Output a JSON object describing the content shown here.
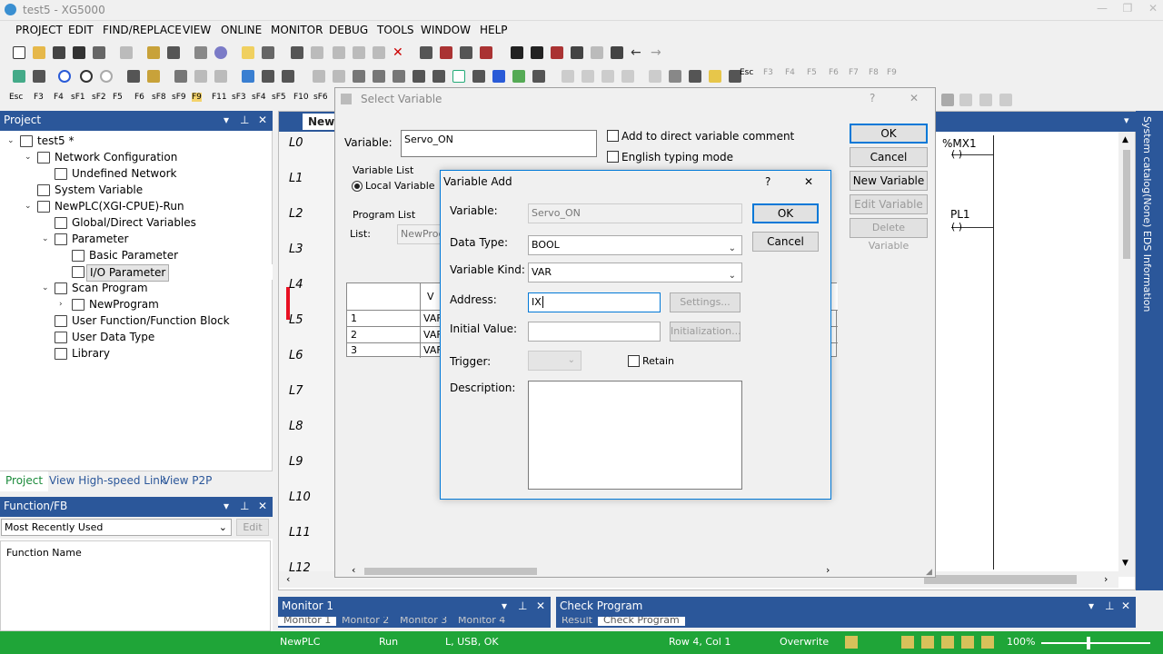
{
  "app": {
    "title": "test5 - XG5000"
  },
  "menu": [
    "PROJECT",
    "EDIT",
    "FIND/REPLACE",
    "VIEW",
    "ONLINE",
    "MONITOR",
    "DEBUG",
    "TOOLS",
    "WINDOW",
    "HELP"
  ],
  "toolbar3": [
    "Esc",
    "F3",
    "F4",
    "sF1",
    "sF2",
    "F5",
    "F6",
    "sF8",
    "sF9",
    "F9",
    "F11",
    "sF3",
    "sF4",
    "sF5",
    "F10",
    "sF6"
  ],
  "toolbar2_right": [
    "Esc",
    "F3",
    "F4",
    "F5",
    "F6",
    "F7",
    "F8",
    "F9"
  ],
  "project_pane": {
    "title": "Project",
    "tree": [
      {
        "label": "test5 *",
        "level": 0,
        "exp": "⌄"
      },
      {
        "label": "Network Configuration",
        "level": 1,
        "exp": "⌄"
      },
      {
        "label": "Undefined Network",
        "level": 2,
        "exp": ""
      },
      {
        "label": "System Variable",
        "level": 1,
        "exp": ""
      },
      {
        "label": "NewPLC(XGI-CPUE)-Run",
        "level": 1,
        "exp": "⌄"
      },
      {
        "label": "Global/Direct Variables",
        "level": 2,
        "exp": ""
      },
      {
        "label": "Parameter",
        "level": 2,
        "exp": "⌄"
      },
      {
        "label": "Basic Parameter",
        "level": 3,
        "exp": ""
      },
      {
        "label": "I/O Parameter",
        "level": 3,
        "exp": ""
      },
      {
        "label": "Scan Program",
        "level": 2,
        "exp": "⌄"
      },
      {
        "label": "NewProgram",
        "level": 3,
        "exp": "›"
      },
      {
        "label": "User Function/Function Block",
        "level": 2,
        "exp": ""
      },
      {
        "label": "User Data Type",
        "level": 2,
        "exp": ""
      },
      {
        "label": "Library",
        "level": 2,
        "exp": ""
      }
    ],
    "tabs": [
      "Project",
      "View High-speed Link",
      "View P2P"
    ]
  },
  "function_pane": {
    "title": "Function/FB",
    "filter": "Most Recently Used",
    "edit": "Edit",
    "col": "Function Name"
  },
  "editor": {
    "tab": "NewF",
    "rungs": [
      "L0",
      "L1",
      "L2",
      "L3",
      "L4",
      "L5",
      "L6",
      "L7",
      "L8",
      "L9",
      "L10",
      "L11",
      "L12"
    ],
    "contacts": [
      "%MX1",
      "PL1"
    ]
  },
  "right_strip": "System catalog(None)  EDS Information",
  "select_variable": {
    "title": "Select Variable",
    "help": "?",
    "close": "✕",
    "variable_label": "Variable:",
    "variable_value": "Servo_ON",
    "add_comment": "Add to direct variable comment",
    "english_mode": "English typing mode",
    "variable_list": "Variable List",
    "local_variable": "Local Variable",
    "program_list": "Program List",
    "list_label": "List:",
    "list_value": "NewProgr",
    "rows": [
      {
        "n": "1",
        "v": "VAF"
      },
      {
        "n": "2",
        "v": "VAF"
      },
      {
        "n": "3",
        "v": "VAF"
      }
    ],
    "col_head": "V",
    "buttons": {
      "ok": "OK",
      "cancel": "Cancel",
      "new": "New Variable",
      "edit": "Edit Variable",
      "delete": "Delete Variable"
    }
  },
  "variable_add": {
    "title": "Variable Add",
    "help": "?",
    "close": "✕",
    "variable_label": "Variable:",
    "variable_value": "Servo_ON",
    "data_type_label": "Data Type:",
    "data_type": "BOOL",
    "kind_label": "Variable Kind:",
    "kind": "VAR",
    "address_label": "Address:",
    "address": "IX",
    "settings": "Settings...",
    "initial_label": "Initial Value:",
    "initial_value": "",
    "initialization": "Initialization...",
    "trigger_label": "Trigger:",
    "retain": "Retain",
    "description_label": "Description:",
    "ok": "OK",
    "cancel": "Cancel"
  },
  "monitor_pane": {
    "title": "Monitor 1",
    "tabs": [
      "Monitor 1",
      "Monitor 2",
      "Monitor 3",
      "Monitor 4"
    ]
  },
  "check_pane": {
    "title": "Check Program",
    "tabs": [
      "Result",
      "Check Program"
    ]
  },
  "status": {
    "plc": "NewPLC",
    "mode": "Run",
    "conn": "L, USB, OK",
    "pos": "Row 4, Col 1",
    "ins": "Overwrite",
    "zoom": "100%"
  },
  "colors": {
    "accent": "#2b579a",
    "status": "#1fa538",
    "rung_marker": "#e81123"
  }
}
